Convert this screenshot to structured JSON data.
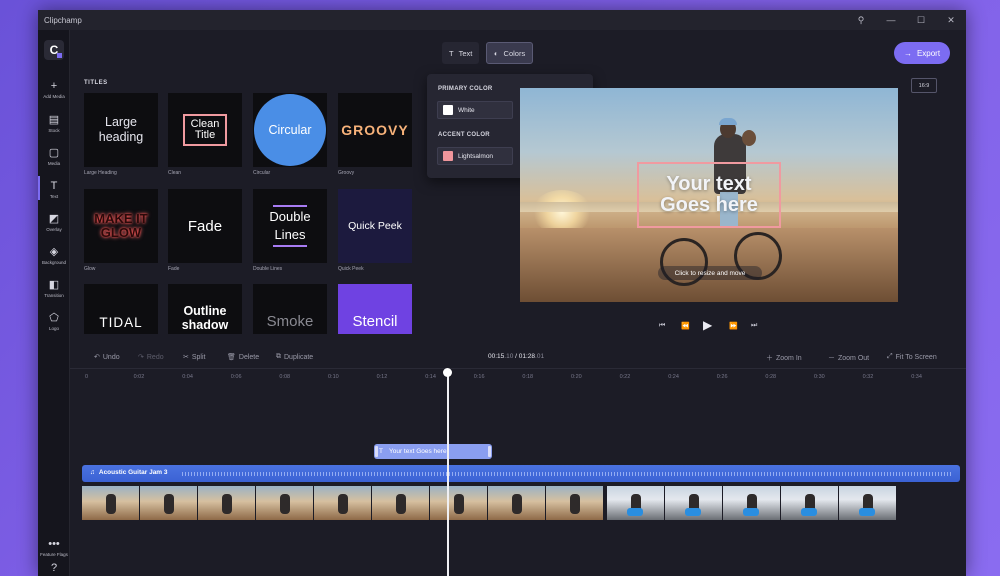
{
  "window": {
    "title": "Clipchamp"
  },
  "titlebar_icons": [
    "pin-icon",
    "minimize-icon",
    "restore-icon",
    "close-icon"
  ],
  "nav": [
    {
      "id": "add-media",
      "label": "Add Media",
      "icon": "+"
    },
    {
      "id": "stock",
      "label": "Stock",
      "icon": "▤"
    },
    {
      "id": "media",
      "label": "Media",
      "icon": "▢"
    },
    {
      "id": "text",
      "label": "Text",
      "icon": "T"
    },
    {
      "id": "overlay",
      "label": "Overlay",
      "icon": "◩"
    },
    {
      "id": "background",
      "label": "Background",
      "icon": "◈"
    },
    {
      "id": "transition",
      "label": "Transition",
      "icon": "◧"
    },
    {
      "id": "logo",
      "label": "Logo",
      "icon": "⬠"
    }
  ],
  "bottom_nav": {
    "feature_label": "Feature Flags",
    "help_icon": "?"
  },
  "toolbar": {
    "text_tab": "Text",
    "colors_tab": "Colors",
    "export_label": "Export",
    "aspect_ratio": "16:9"
  },
  "titles_panel": {
    "heading": "TITLES",
    "tiles": [
      {
        "id": "large-heading",
        "label_line1": "Large",
        "label_line2": "heading",
        "caption": "Large Heading"
      },
      {
        "id": "clean",
        "label_line1": "Clean",
        "label_line2": "Title",
        "caption": "Clean"
      },
      {
        "id": "circular",
        "label_line1": "Circular",
        "caption": "Circular"
      },
      {
        "id": "groovy",
        "label_line1": "GROOVY",
        "caption": "Groovy"
      },
      {
        "id": "glow",
        "label_line1": "MAKE IT",
        "label_line2": "GLOW",
        "caption": "Glow"
      },
      {
        "id": "fade",
        "label_line1": "Fade",
        "caption": "Fade"
      },
      {
        "id": "double-lines",
        "label_line1": "Double",
        "label_line2": "Lines",
        "caption": "Double Lines"
      },
      {
        "id": "quick-peek",
        "label_line1": "Quick Peek",
        "caption": "Quick Peek"
      },
      {
        "id": "tidal",
        "label_line1": "TIDAL"
      },
      {
        "id": "outline-shadow",
        "label_line1": "Outline",
        "label_line2": "shadow"
      },
      {
        "id": "smoke",
        "label_line1": "Smoke"
      },
      {
        "id": "stencil",
        "label_line1": "Stencil"
      }
    ]
  },
  "colors_popup": {
    "primary_heading": "PRIMARY COLOR",
    "primary_name": "White",
    "primary_hex": "#ffffff",
    "accent_heading": "ACCENT COLOR",
    "accent_name": "Lightsalmon",
    "accent_hex": "#f0969c"
  },
  "preview": {
    "overlay_line1": "Your text",
    "overlay_line2": "Goes here",
    "hint": "Click to resize and move"
  },
  "playback": {
    "icons": [
      "skip-back-icon",
      "rewind-icon",
      "play-icon",
      "fast-forward-icon",
      "skip-forward-icon"
    ]
  },
  "timeline": {
    "undo": "Undo",
    "redo": "Redo",
    "split": "Split",
    "delete": "Delete",
    "duplicate": "Duplicate",
    "time_current": "00:15",
    "time_current_frac": ".10",
    "time_sep": " / ",
    "time_total": "01:28",
    "time_total_frac": ".01",
    "zoom_in": "Zoom In",
    "zoom_out": "Zoom Out",
    "fit": "Fit To Screen",
    "ticks": [
      "0",
      "0:02",
      "0:04",
      "0:06",
      "0:08",
      "0:10",
      "0:12",
      "0:14",
      "0:16",
      "0:18",
      "0:20",
      "0:22",
      "0:24",
      "0:26",
      "0:28",
      "0:30",
      "0:32",
      "0:34"
    ],
    "text_clip_label": "Your text Goes here",
    "audio_clip_label": "Acoustic Guitar Jam 3"
  },
  "accent_color": "#7c6cf2"
}
